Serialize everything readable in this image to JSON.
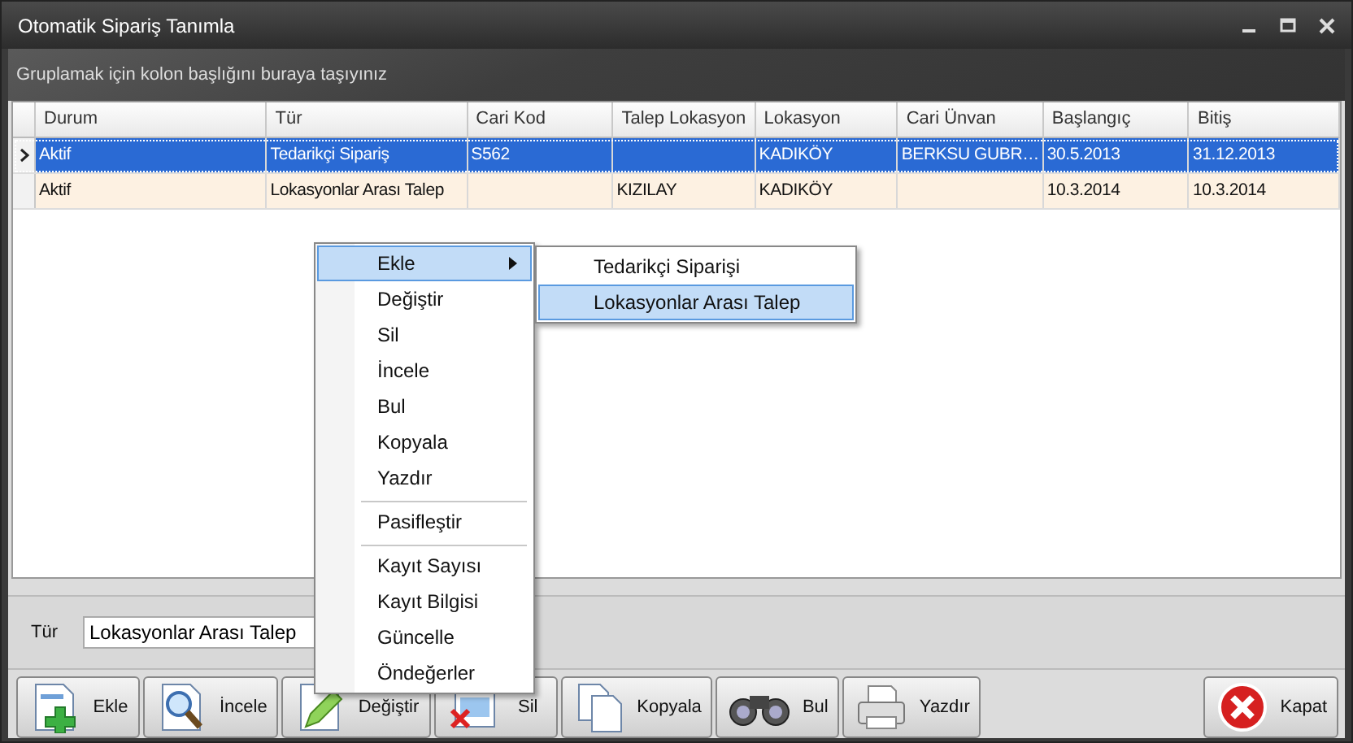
{
  "window": {
    "title": "Otomatik Sipariş Tanımla"
  },
  "group_panel": {
    "hint": "Gruplamak için kolon başlığını buraya taşıyınız"
  },
  "table": {
    "columns": [
      "Durum",
      "Tür",
      "Cari Kod",
      "Talep Lokasyon",
      "Lokasyon",
      "Cari Ünvan",
      "Başlangıç",
      "Bitiş"
    ],
    "rows": [
      {
        "selected": true,
        "cells": [
          "Aktif",
          "Tedarikçi Sipariş",
          "S562",
          "",
          "KADIKÖY",
          "BERKSU GUBR…",
          "30.5.2013",
          "31.12.2013"
        ]
      },
      {
        "selected": false,
        "cells": [
          "Aktif",
          "Lokasyonlar Arası Talep",
          "",
          "KIZILAY",
          "KADIKÖY",
          "",
          "10.3.2014",
          "10.3.2014"
        ]
      }
    ]
  },
  "filter": {
    "label": "Tür",
    "value": "Lokasyonlar Arası Talep"
  },
  "buttons": [
    {
      "label": "Ekle"
    },
    {
      "label": "İncele"
    },
    {
      "label": "Değiştir"
    },
    {
      "label": "Sil"
    },
    {
      "label": "Kopyala"
    },
    {
      "label": "Bul"
    },
    {
      "label": "Yazdır"
    },
    {
      "label": "Kapat"
    }
  ],
  "context_menu": {
    "items": [
      {
        "label": "Ekle",
        "selected": true,
        "has_submenu": true,
        "separator_before": false
      },
      {
        "label": "Değiştir",
        "selected": false,
        "has_submenu": false,
        "separator_before": false
      },
      {
        "label": "Sil",
        "selected": false,
        "has_submenu": false,
        "separator_before": false
      },
      {
        "label": "İncele",
        "selected": false,
        "has_submenu": false,
        "separator_before": false
      },
      {
        "label": "Bul",
        "selected": false,
        "has_submenu": false,
        "separator_before": false
      },
      {
        "label": "Kopyala",
        "selected": false,
        "has_submenu": false,
        "separator_before": false
      },
      {
        "label": "Yazdır",
        "selected": false,
        "has_submenu": false,
        "separator_before": false
      },
      {
        "label": "Pasifleştir",
        "selected": false,
        "has_submenu": false,
        "separator_before": true
      },
      {
        "label": "Kayıt Sayısı",
        "selected": false,
        "has_submenu": false,
        "separator_before": true
      },
      {
        "label": "Kayıt Bilgisi",
        "selected": false,
        "has_submenu": false,
        "separator_before": false
      },
      {
        "label": "Güncelle",
        "selected": false,
        "has_submenu": false,
        "separator_before": false
      },
      {
        "label": "Öndeğerler",
        "selected": false,
        "has_submenu": false,
        "separator_before": false
      }
    ],
    "submenu": [
      {
        "label": "Tedarikçi Siparişi",
        "selected": false
      },
      {
        "label": "Lokasyonlar Arası Talep",
        "selected": true
      }
    ]
  }
}
